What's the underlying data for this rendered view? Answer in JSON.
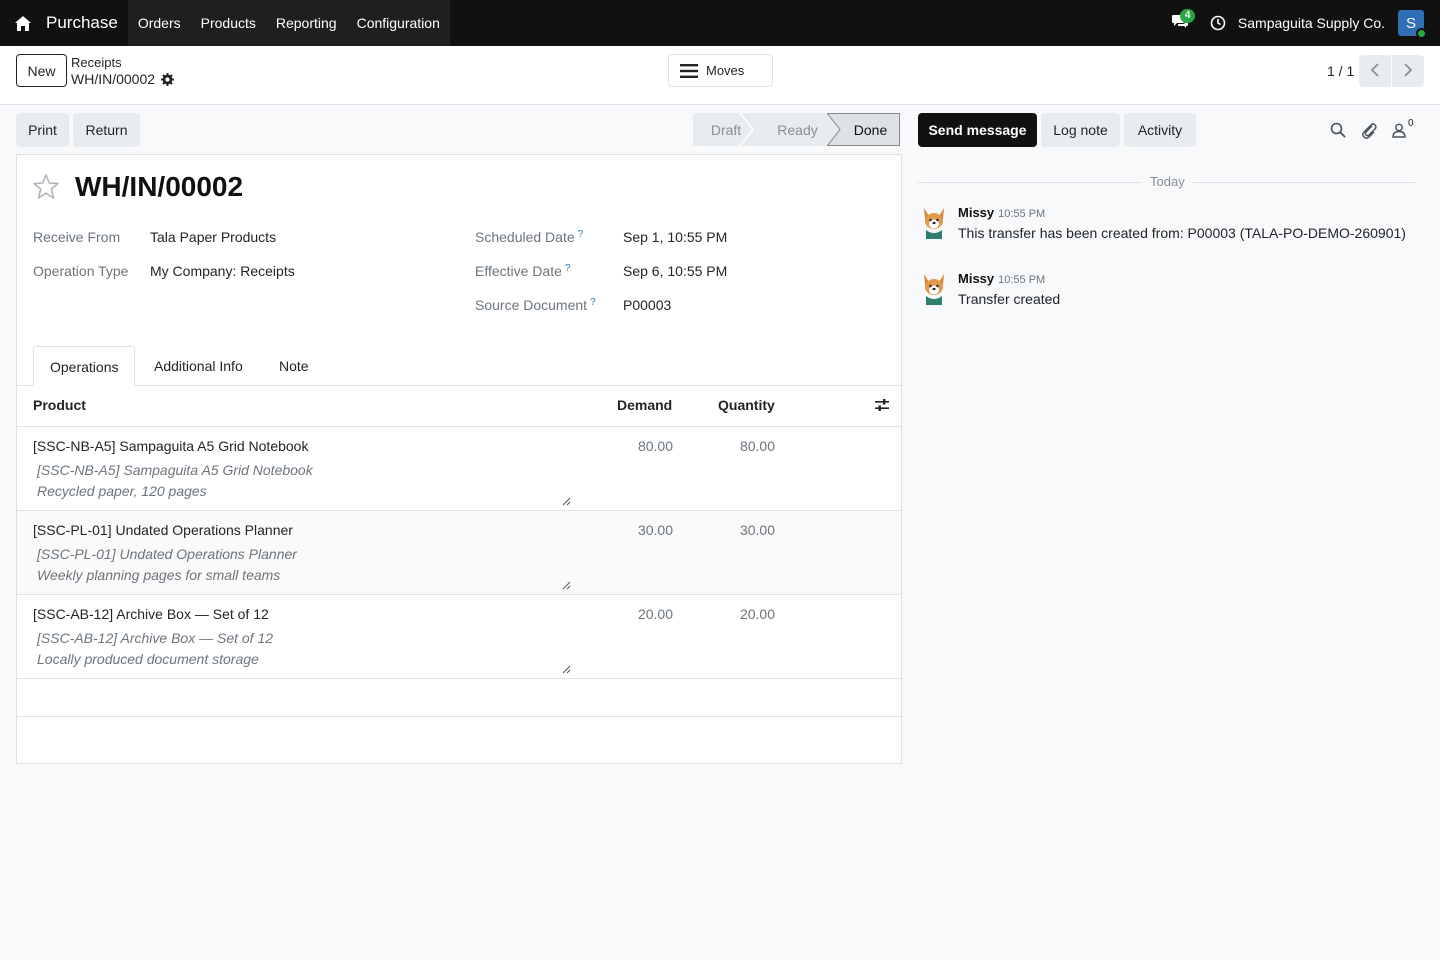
{
  "navbar": {
    "app_name": "Purchase",
    "menu": [
      "Orders",
      "Products",
      "Reporting",
      "Configuration"
    ],
    "chat_badge": "4",
    "company": "Sampaguita Supply Co.",
    "avatar_letter": "S"
  },
  "control": {
    "new_label": "New",
    "breadcrumb_parent": "Receipts",
    "breadcrumb_current": "WH/IN/00002",
    "moves_label": "Moves",
    "pager": "1 / 1"
  },
  "actions": {
    "print_label": "Print",
    "return_label": "Return"
  },
  "status": {
    "steps": [
      "Draft",
      "Ready",
      "Done"
    ],
    "active": "Done"
  },
  "record": {
    "name": "WH/IN/00002",
    "fields_left": [
      {
        "label": "Receive From",
        "value": "Tala Paper Products"
      },
      {
        "label": "Operation Type",
        "value": "My Company: Receipts"
      }
    ],
    "fields_right": [
      {
        "label": "Scheduled Date",
        "value": "Sep 1, 10:55 PM"
      },
      {
        "label": "Effective Date",
        "value": "Sep 6, 10:55 PM"
      },
      {
        "label": "Source Document",
        "value": "P00003"
      }
    ],
    "help_mark": "?"
  },
  "tabs": [
    "Operations",
    "Additional Info",
    "Note"
  ],
  "table": {
    "headers": {
      "product": "Product",
      "demand": "Demand",
      "quantity": "Quantity"
    },
    "rows": [
      {
        "product": "[SSC-NB-A5] Sampaguita A5 Grid Notebook",
        "desc1": "[SSC-NB-A5] Sampaguita A5 Grid Notebook",
        "desc2": "Recycled paper, 120 pages",
        "demand": "80.00",
        "quantity": "80.00"
      },
      {
        "product": "[SSC-PL-01] Undated Operations Planner",
        "desc1": "[SSC-PL-01] Undated Operations Planner",
        "desc2": "Weekly planning pages for small teams",
        "demand": "30.00",
        "quantity": "30.00"
      },
      {
        "product": "[SSC-AB-12] Archive Box — Set of 12",
        "desc1": "[SSC-AB-12] Archive Box — Set of 12",
        "desc2": "Locally produced document storage",
        "demand": "20.00",
        "quantity": "20.00"
      }
    ]
  },
  "chatter": {
    "send_label": "Send message",
    "log_label": "Log note",
    "activity_label": "Activity",
    "follower_count": "0",
    "date_divider": "Today",
    "messages": [
      {
        "author": "Missy",
        "time": "10:55 PM",
        "body": "This transfer has been created from: P00003 (TALA-PO-DEMO-260901)"
      },
      {
        "author": "Missy",
        "time": "10:55 PM",
        "body": "Transfer created"
      }
    ]
  },
  "colors": {
    "navbar": "#111111",
    "status_active": "#dee2e6",
    "online": "#28a745",
    "avatar": "#2f6fb6"
  }
}
